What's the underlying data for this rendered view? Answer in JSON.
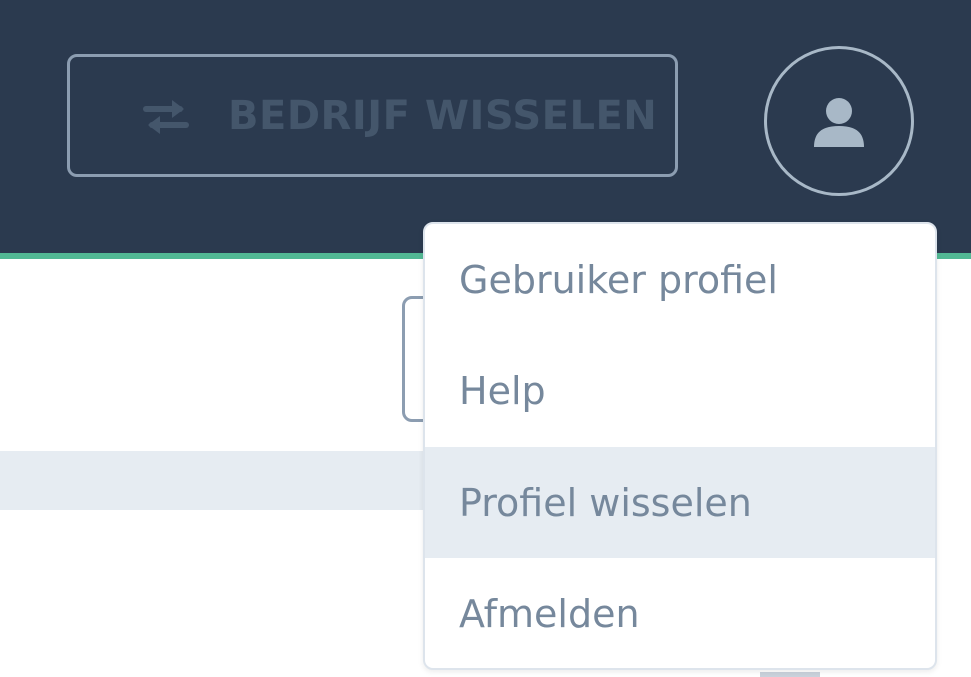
{
  "header": {
    "switch_company_label": "BEDRIJF WISSELEN",
    "switch_icon": "arrows-exchange-icon",
    "avatar_icon": "user-icon"
  },
  "user_menu": {
    "items": [
      {
        "label": "Gebruiker profiel",
        "active": false
      },
      {
        "label": "Help",
        "active": false
      },
      {
        "label": "Profiel wisselen",
        "active": true
      },
      {
        "label": "Afmelden",
        "active": false
      }
    ]
  },
  "colors": {
    "header_bg": "#2b3a4f",
    "accent": "#52b894",
    "menu_text": "#76889c",
    "highlight": "#e6ecf2"
  }
}
